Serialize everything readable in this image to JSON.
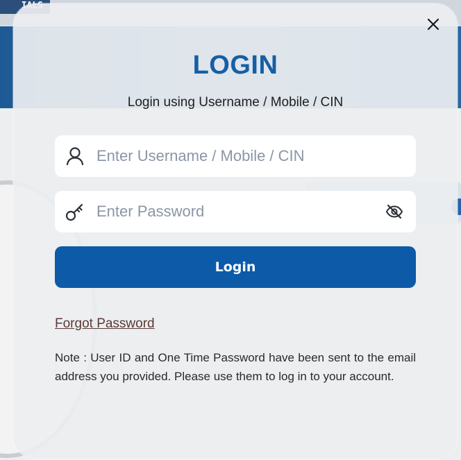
{
  "background": {
    "topbar_label": "IALS"
  },
  "modal": {
    "title": "LOGIN",
    "subtitle": "Login using Username / Mobile / CIN",
    "close_icon": "close-icon",
    "username": {
      "icon": "user-icon",
      "value": "",
      "placeholder": "Enter Username / Mobile / CIN"
    },
    "password": {
      "icon": "key-icon",
      "value": "",
      "placeholder": "Enter Password",
      "toggle_icon": "eye-slash-icon"
    },
    "login_label": "Login",
    "forgot_label": "Forgot Password",
    "note": "Note : User ID and One Time Password have been sent to the email address you provided. Please use them to log in to your account."
  },
  "colors": {
    "accent": "#155fa6",
    "button": "#0d5aa9",
    "link": "#5a3a35"
  }
}
